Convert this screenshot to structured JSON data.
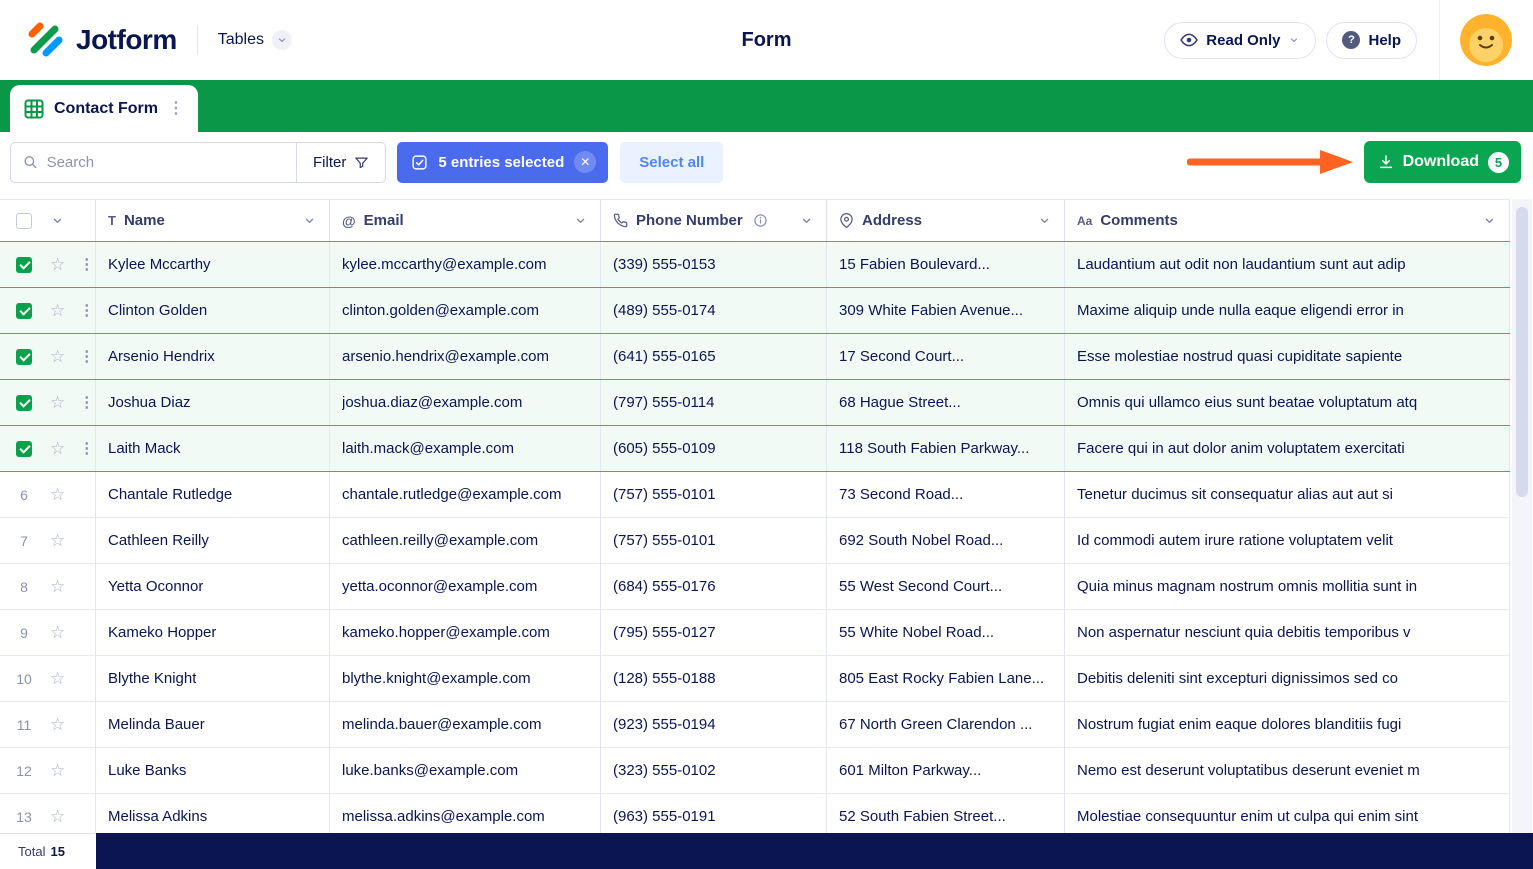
{
  "colors": {
    "brand_navy": "#0a1551",
    "brand_green": "#0a9848",
    "download_green": "#0aa551",
    "selection_blue": "#4b6bef",
    "select_all_blue": "#4e87f0",
    "selected_row_bg": "#f2faf5",
    "selected_row_border": "#43ad74",
    "annotation_orange": "#ff6321"
  },
  "icons": {
    "close": "✕",
    "kebab": "⋮",
    "star": "☆",
    "text_column": "T",
    "at": "@",
    "aa": "Aa"
  },
  "header": {
    "logo_text": "Jotform",
    "tables_label": "Tables",
    "page_title": "Form",
    "read_only_label": "Read Only",
    "help_label": "Help"
  },
  "tab": {
    "label": "Contact Form"
  },
  "toolbar": {
    "search_placeholder": "Search",
    "filter_label": "Filter",
    "selected_label": "5 entries selected",
    "select_all_label": "Select all",
    "download_label": "Download",
    "download_badge": "5"
  },
  "table": {
    "columns": [
      {
        "label": "Name",
        "icon": "text-column-icon",
        "info": false
      },
      {
        "label": "Email",
        "icon": "at-icon",
        "info": false
      },
      {
        "label": "Phone Number",
        "icon": "phone-icon",
        "info": true
      },
      {
        "label": "Address",
        "icon": "location-icon",
        "info": false
      },
      {
        "label": "Comments",
        "icon": "aa-icon",
        "info": false
      }
    ],
    "rows": [
      {
        "index": 1,
        "selected": true,
        "name": "Kylee Mccarthy",
        "email": "kylee.mccarthy@example.com",
        "phone": "(339) 555-0153",
        "address": "15 Fabien Boulevard...",
        "comments": "Laudantium aut odit non laudantium sunt aut adip"
      },
      {
        "index": 2,
        "selected": true,
        "name": "Clinton Golden",
        "email": "clinton.golden@example.com",
        "phone": "(489) 555-0174",
        "address": "309 White Fabien Avenue...",
        "comments": "Maxime aliquip unde nulla eaque eligendi error in"
      },
      {
        "index": 3,
        "selected": true,
        "name": "Arsenio Hendrix",
        "email": "arsenio.hendrix@example.com",
        "phone": "(641) 555-0165",
        "address": "17 Second Court...",
        "comments": "Esse molestiae nostrud quasi cupiditate sapiente"
      },
      {
        "index": 4,
        "selected": true,
        "name": "Joshua Diaz",
        "email": "joshua.diaz@example.com",
        "phone": "(797) 555-0114",
        "address": "68 Hague Street...",
        "comments": "Omnis qui ullamco eius sunt beatae voluptatum atq"
      },
      {
        "index": 5,
        "selected": true,
        "name": "Laith Mack",
        "email": "laith.mack@example.com",
        "phone": "(605) 555-0109",
        "address": "118 South Fabien Parkway...",
        "comments": "Facere qui in aut dolor anim voluptatem exercitati"
      },
      {
        "index": 6,
        "selected": false,
        "name": "Chantale Rutledge",
        "email": "chantale.rutledge@example.com",
        "phone": "(757) 555-0101",
        "address": "73 Second Road...",
        "comments": "Tenetur ducimus sit consequatur alias aut aut si"
      },
      {
        "index": 7,
        "selected": false,
        "name": "Cathleen Reilly",
        "email": "cathleen.reilly@example.com",
        "phone": "(757) 555-0101",
        "address": "692 South Nobel Road...",
        "comments": "Id commodi autem irure ratione voluptatem velit"
      },
      {
        "index": 8,
        "selected": false,
        "name": "Yetta Oconnor",
        "email": "yetta.oconnor@example.com",
        "phone": "(684) 555-0176",
        "address": "55 West Second Court...",
        "comments": "Quia minus magnam nostrum omnis mollitia sunt in"
      },
      {
        "index": 9,
        "selected": false,
        "name": "Kameko Hopper",
        "email": "kameko.hopper@example.com",
        "phone": "(795) 555-0127",
        "address": "55 White Nobel Road...",
        "comments": "Non aspernatur nesciunt quia debitis temporibus v"
      },
      {
        "index": 10,
        "selected": false,
        "name": "Blythe Knight",
        "email": "blythe.knight@example.com",
        "phone": "(128) 555-0188",
        "address": "805 East Rocky Fabien Lane...",
        "comments": "Debitis deleniti sint excepturi dignissimos sed co"
      },
      {
        "index": 11,
        "selected": false,
        "name": "Melinda Bauer",
        "email": "melinda.bauer@example.com",
        "phone": "(923) 555-0194",
        "address": "67 North Green Clarendon ...",
        "comments": "Nostrum fugiat enim eaque dolores blanditiis fugi"
      },
      {
        "index": 12,
        "selected": false,
        "name": "Luke Banks",
        "email": "luke.banks@example.com",
        "phone": "(323) 555-0102",
        "address": "601 Milton Parkway...",
        "comments": "Nemo est deserunt voluptatibus deserunt eveniet m"
      },
      {
        "index": 13,
        "selected": false,
        "name": "Melissa Adkins",
        "email": "melissa.adkins@example.com",
        "phone": "(963) 555-0191",
        "address": "52 South Fabien Street...",
        "comments": "Molestiae consequuntur enim ut culpa qui enim sint"
      }
    ]
  },
  "footer": {
    "total_label": "Total",
    "total_value": "15"
  }
}
